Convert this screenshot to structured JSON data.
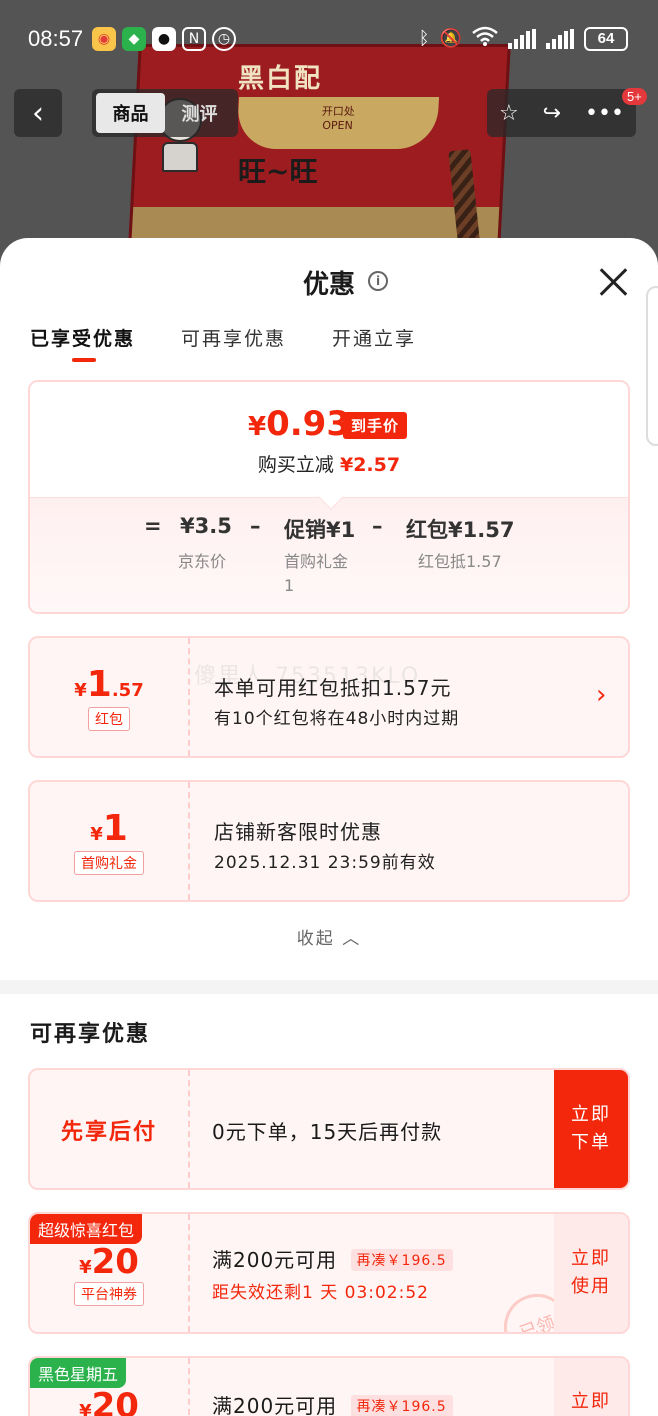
{
  "status_bar": {
    "time": "08:57",
    "battery": "64"
  },
  "product_image": {
    "brand_text": "黑白配",
    "lid_text_1": "开口处",
    "lid_text_2": "OPEN",
    "wang_text": "旺~旺"
  },
  "nav": {
    "tabs": [
      {
        "label": "商品"
      },
      {
        "label": "测评"
      }
    ],
    "badge": "5+"
  },
  "sheet": {
    "title": "优惠",
    "tabs": [
      {
        "label": "已享受优惠"
      },
      {
        "label": "可再享优惠"
      },
      {
        "label": "开通立享"
      }
    ]
  },
  "summary": {
    "yen": "¥",
    "final_price": "0.93",
    "final_tag": "到手价",
    "reduce_label": "购买立减",
    "reduce_amount": "¥2.57",
    "calc": {
      "eq": "=",
      "jd_price": "¥3.5",
      "jd_label": "京东价",
      "minus": "–",
      "promo": "促销¥1",
      "promo_label_1": "首购礼金",
      "promo_label_2": "1",
      "redpacket": "红包¥1.57",
      "redpacket_label": "红包抵1.57"
    }
  },
  "coupons": [
    {
      "yen": "¥",
      "amount_big": "1",
      "amount_small": ".57",
      "tag": "红包",
      "line1": "本单可用红包抵扣1.57元",
      "line2": "有10个红包将在48小时内过期",
      "watermark": "傻里人 753513KLO"
    },
    {
      "yen": "¥",
      "amount_big": "1",
      "amount_small": "",
      "tag": "首购礼金",
      "line1": "店铺新客限时优惠",
      "line2": "2025.12.31 23:59前有效"
    }
  ],
  "collapse_label": "收起",
  "more_section": {
    "title": "可再享优惠",
    "items": [
      {
        "left_title": "先享后付",
        "line1": "0元下单，15天后再付款",
        "btn_1": "立即",
        "btn_2": "下单"
      },
      {
        "badge": "超级惊喜红包",
        "badge_color": "#f2270c",
        "yen": "¥",
        "amount": "20",
        "tag": "平台神券",
        "line1": "满200元可用",
        "addon": "再凑￥196.5",
        "line2": "距失效还剩1 天 03:02:52",
        "btn_1": "立即",
        "btn_2": "使用",
        "stamp": "已领"
      },
      {
        "badge": "黑色星期五",
        "badge_color": "#2bb24c",
        "yen": "¥",
        "amount": "20",
        "line1": "满200元可用",
        "addon": "再凑￥196.5",
        "btn_1": "立即"
      }
    ]
  }
}
